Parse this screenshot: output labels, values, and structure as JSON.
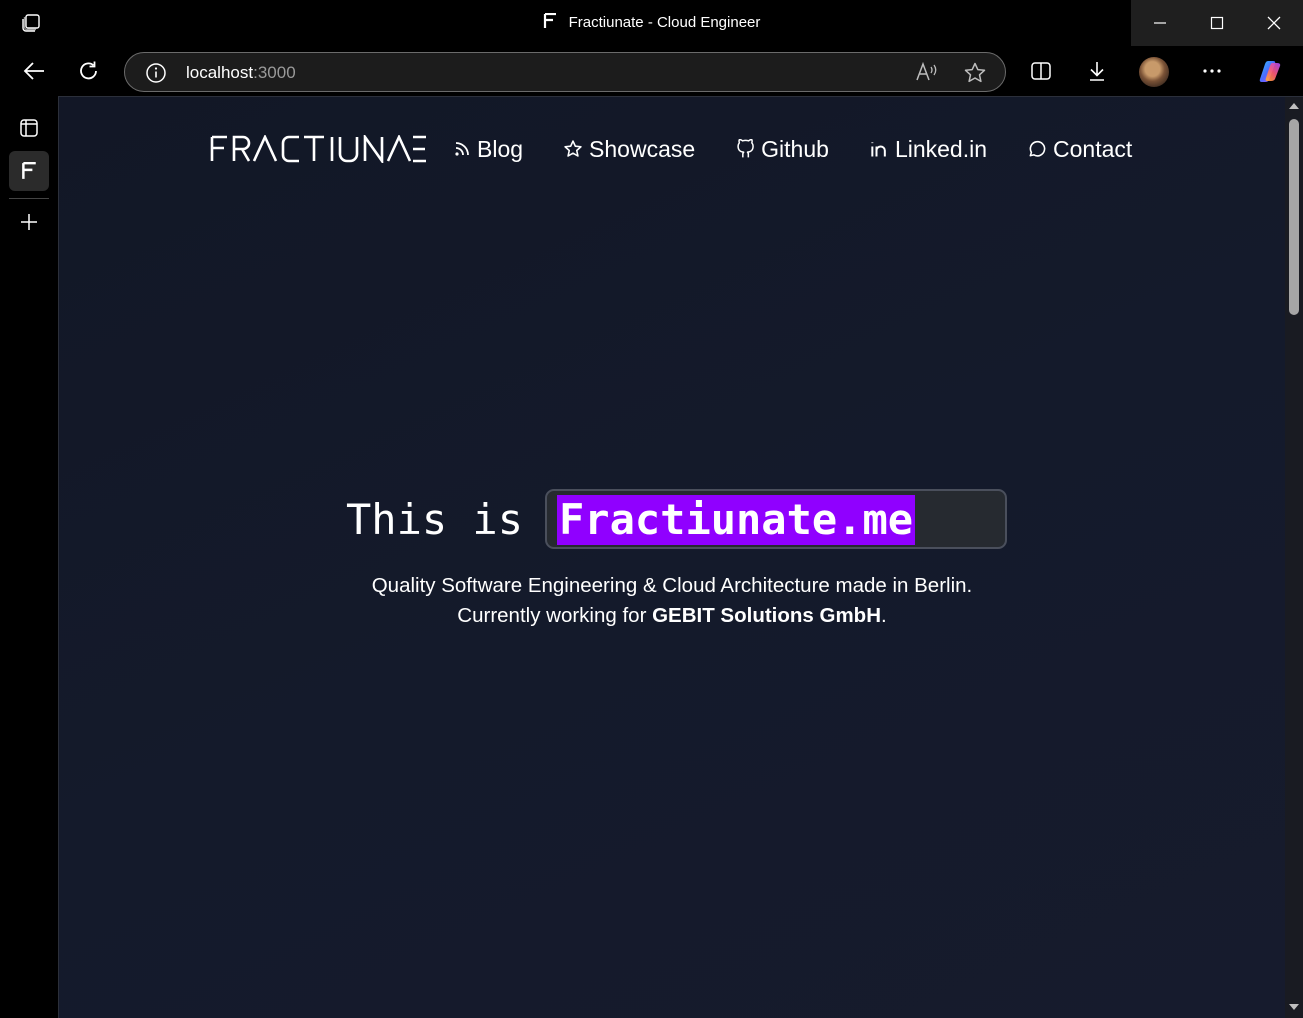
{
  "window": {
    "title": "Fractiunate - Cloud Engineer"
  },
  "addressbar": {
    "host": "localhost",
    "port": ":3000"
  },
  "nav": {
    "logo_text": "FRACTIUNATE",
    "links": [
      {
        "label": "Blog",
        "icon": "rss-icon"
      },
      {
        "label": "Showcase",
        "icon": "star-icon"
      },
      {
        "label": "Github",
        "icon": "github-icon"
      },
      {
        "label": "Linked.in",
        "icon": "linkedin-icon"
      },
      {
        "label": "Contact",
        "icon": "chat-bubble-icon"
      }
    ]
  },
  "hero": {
    "prefix": "This is",
    "highlight": "Fractiunate.me",
    "tagline_line1": "Quality Software Engineering & Cloud Architecture made in Berlin.",
    "tagline_line2_pre": "Currently working for ",
    "tagline_line2_bold": "GEBIT Solutions GmbH",
    "tagline_line2_post": "."
  },
  "colors": {
    "page_bg": "#141a2b",
    "highlight_bg": "#9000ff",
    "browser_chrome": "#000000"
  }
}
